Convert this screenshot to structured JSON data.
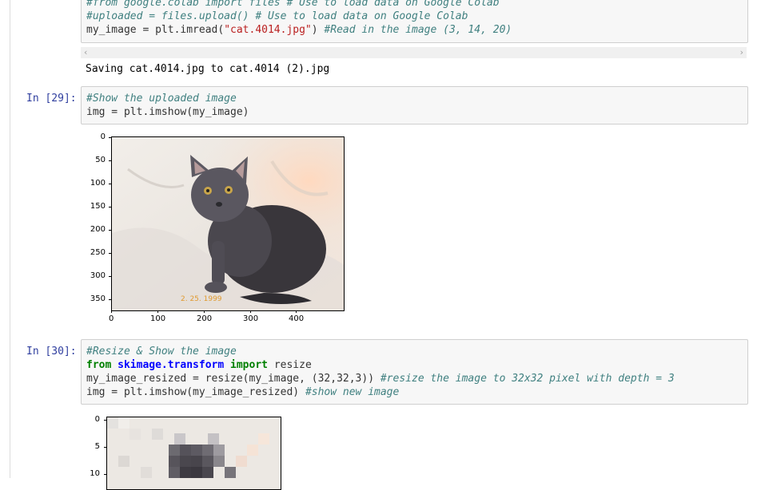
{
  "cell1": {
    "line1": "#from google.colab import files # Use to load data on Google Colab",
    "line2": "#uploaded = files.upload() # Use to load data on Google Colab",
    "line3_code_a": "my_image = plt.imread(",
    "line3_string": "\"cat.4014.jpg\"",
    "line3_code_b": ") ",
    "line3_comment": "#Read in the image (3, 14, 20)",
    "output": "Saving cat.4014.jpg to cat.4014 (2).jpg"
  },
  "cell2": {
    "prompt": "In [29]:",
    "line1": "#Show the uploaded image",
    "line2": "img = plt.imshow(my_image)",
    "plot": {
      "y_ticks": [
        "0",
        "50",
        "100",
        "150",
        "200",
        "250",
        "300",
        "350"
      ],
      "x_ticks": [
        "0",
        "100",
        "200",
        "300",
        "400"
      ],
      "stamp": "2. 25. 1999"
    }
  },
  "cell3": {
    "prompt": "In [30]:",
    "line1": "#Resize & Show the image",
    "line2_kw1": "from",
    "line2_mod": "skimage.transform",
    "line2_kw2": "import",
    "line2_rest": "resize",
    "line3_code": "my_image_resized = resize(my_image, (32,32,3)) ",
    "line3_comment": "#resize the image to 32x32 pixel with depth = 3",
    "line4_code": "img = plt.imshow(my_image_resized) ",
    "line4_comment": "#show new image",
    "plot": {
      "y_ticks": [
        "0",
        "5",
        "10"
      ]
    }
  },
  "colors": {
    "prompt": "#303f9f",
    "comment": "#408080",
    "string": "#ba2121",
    "keyword": "#008000",
    "module": "#0000ff",
    "stamp": "#e09a30"
  }
}
